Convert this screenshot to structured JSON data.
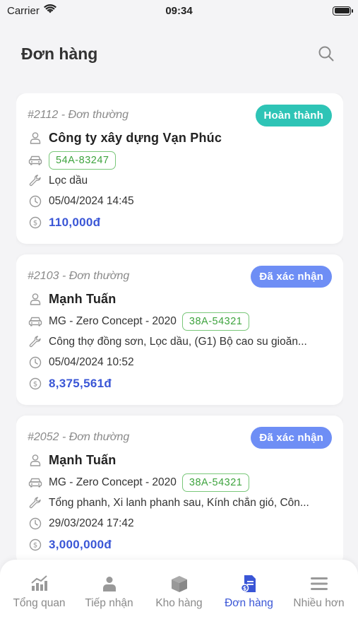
{
  "status_bar": {
    "carrier": "Carrier",
    "time": "09:34"
  },
  "header": {
    "title": "Đơn hàng"
  },
  "orders": [
    {
      "code": "#2112 - Đơn thường",
      "status": "Hoàn thành",
      "customer": "Công ty xây dựng Vạn Phúc",
      "vehicle": "",
      "plate": "54A-83247",
      "services": "Lọc dầu",
      "datetime": "05/04/2024 14:45",
      "total": "110,000đ"
    },
    {
      "code": "#2103 - Đơn thường",
      "status": "Đã xác nhận",
      "customer": "Mạnh Tuấn",
      "vehicle": "MG - Zero Concept - 2020",
      "plate": "38A-54321",
      "services": "Công thợ đồng sơn, Lọc dầu, (G1) Bộ cao su gioăn...",
      "datetime": "05/04/2024 10:52",
      "total": "8,375,561đ"
    },
    {
      "code": "#2052 - Đơn thường",
      "status": "Đã xác nhận",
      "customer": "Mạnh Tuấn",
      "vehicle": "MG - Zero Concept - 2020",
      "plate": "38A-54321",
      "services": "Tổng phanh, Xi lanh phanh sau, Kính chắn gió, Côn...",
      "datetime": "29/03/2024 17:42",
      "total": "3,000,000đ"
    }
  ],
  "tabs": [
    {
      "label": "Tổng quan",
      "icon": "chart-icon"
    },
    {
      "label": "Tiếp nhận",
      "icon": "user-icon"
    },
    {
      "label": "Kho hàng",
      "icon": "box-icon"
    },
    {
      "label": "Đơn hàng",
      "icon": "order-icon",
      "active": true
    },
    {
      "label": "Nhiều hơn",
      "icon": "menu-icon"
    }
  ],
  "colors": {
    "accent": "#3a56d6",
    "done_badge": "#2ec4b6",
    "confirmed_badge": "#6e8ef5",
    "plate_green": "#3ea33e"
  }
}
